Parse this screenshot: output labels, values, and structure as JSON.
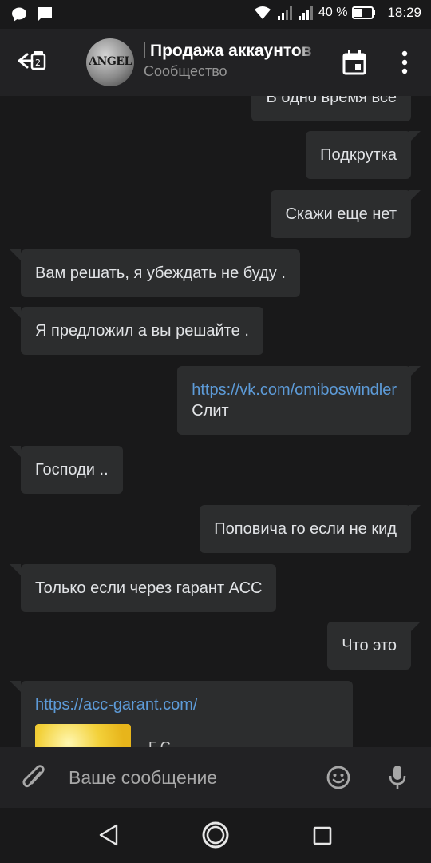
{
  "status_bar": {
    "battery": "40 %",
    "time": "18:29",
    "icons": [
      "chat-bubble-icon",
      "message-icon",
      "wifi-icon",
      "signal-icon",
      "signal-icon",
      "battery-icon"
    ]
  },
  "header": {
    "title": "Продажа аккаунтов",
    "subtitle": "Сообщество",
    "avatar_text": "ANGEL"
  },
  "messages": [
    {
      "side": "out",
      "text": "В одно время все"
    },
    {
      "side": "out",
      "text": "Подкрутка"
    },
    {
      "side": "out",
      "text": "Скажи еще нет"
    },
    {
      "side": "in",
      "text": "Вам решать, я убеждать не буду ."
    },
    {
      "side": "in",
      "text": "Я предложил а вы решайте ."
    },
    {
      "side": "out",
      "link": "https://vk.com/omiboswindler",
      "text": "Слит"
    },
    {
      "side": "in",
      "text": "Господи .."
    },
    {
      "side": "out",
      "text": "Поповича го если не кид"
    },
    {
      "side": "in",
      "text": "Только если через гарант АСС"
    },
    {
      "side": "out",
      "text": "Что это"
    },
    {
      "side": "in",
      "link": "https://acc-garant.com/",
      "preview_text": "Г         С"
    }
  ],
  "input": {
    "placeholder": "Ваше сообщение"
  },
  "colors": {
    "background": "#19191a",
    "header": "#222224",
    "bubble": "#2c2d2e",
    "text": "#e1e3e6",
    "link": "#5d9bd8",
    "muted": "#939393"
  }
}
